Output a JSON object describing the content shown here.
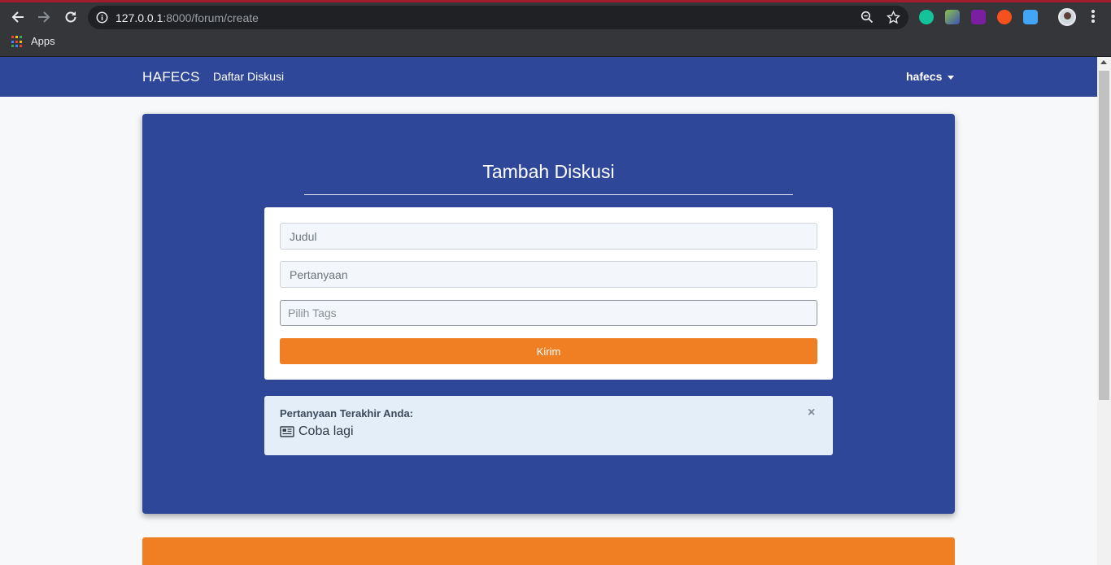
{
  "browser": {
    "url_host": "127.0.0.1",
    "url_rest": ":8000/forum/create",
    "bookmarks": {
      "apps_label": "Apps"
    },
    "extension_icons": [
      "grammarly-icon",
      "extension-green-icon",
      "extension-purple-icon",
      "extension-orange-icon",
      "extension-blue-icon"
    ]
  },
  "navbar": {
    "brand": "HAFECS",
    "link": "Daftar Diskusi",
    "user": "hafecs"
  },
  "main": {
    "title": "Tambah Diskusi",
    "form": {
      "judul_placeholder": "Judul",
      "pertanyaan_placeholder": "Pertanyaan",
      "tags_placeholder": "Pilih Tags",
      "submit_label": "Kirim"
    },
    "alert": {
      "heading": "Pertanyaan Terakhir Anda:",
      "close": "×",
      "item": "Coba lagi"
    }
  },
  "colors": {
    "primary": "#2e4798",
    "accent": "#f07f24",
    "alert_bg": "#e3eef9"
  }
}
